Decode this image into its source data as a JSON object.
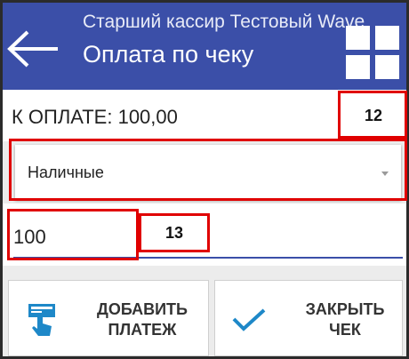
{
  "header": {
    "subtitle": "Старший кассир Тестовый Wave",
    "title": "Оплата по чеку",
    "back_icon": "back-arrow-icon",
    "menu_icon": "grid-icon"
  },
  "payment": {
    "amount_label": "К ОПЛАТЕ: 100,00",
    "method": "Наличные",
    "amount_value": "100"
  },
  "buttons": {
    "add_payment": "ДОБАВИТЬ ПЛАТЕЖ",
    "close_check": "ЗАКРЫТЬ ЧЕК"
  },
  "callouts": {
    "method_marker": "12",
    "amount_marker": "13"
  },
  "colors": {
    "appbar": "#3b4fa8",
    "accent": "#3b4fa8",
    "check": "#1e88c8",
    "annotation": "#e00000"
  }
}
